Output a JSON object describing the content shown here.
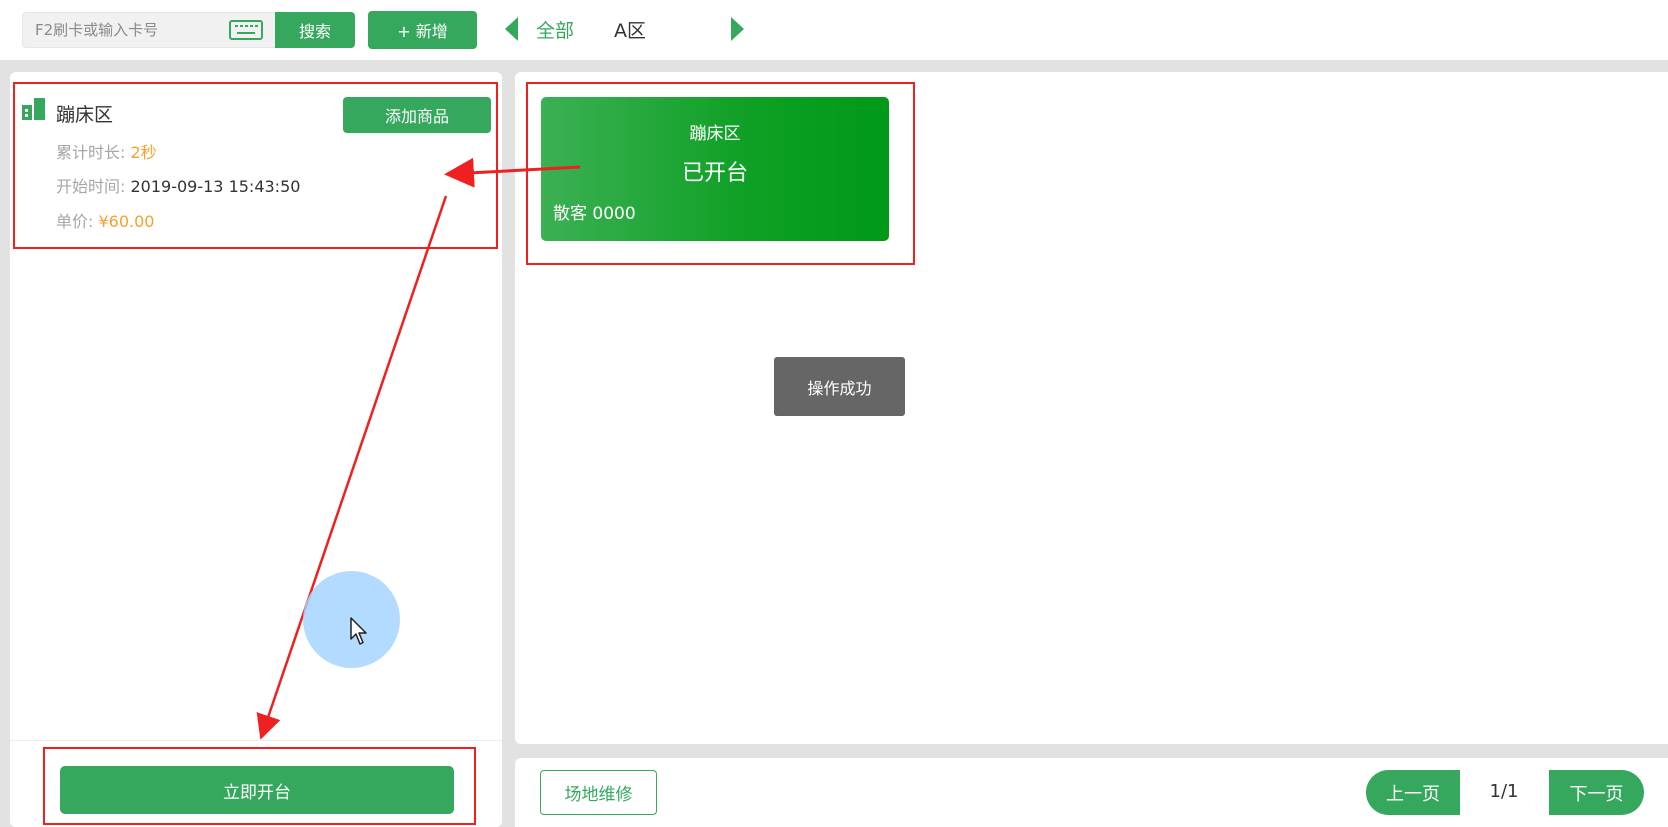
{
  "topbar": {
    "search_placeholder": "F2刷卡或输入卡号",
    "search_label": "搜索",
    "add_label": "+ 新增",
    "tabs": [
      {
        "label": "全部",
        "active": true
      },
      {
        "label": "A区",
        "active": false
      }
    ]
  },
  "left": {
    "venue_name": "蹦床区",
    "add_goods_label": "添加商品",
    "duration_label": "累计时长:",
    "duration_value": "2秒",
    "start_label": "开始时间:",
    "start_value": "2019-09-13 15:43:50",
    "price_label": "单价:",
    "price_value": "¥60.00",
    "open_now_label": "立即开台"
  },
  "card": {
    "name": "蹦床区",
    "status": "已开台",
    "guest": "散客 0000"
  },
  "toast": {
    "message": "操作成功"
  },
  "bottom": {
    "repair_label": "场地维修",
    "prev_label": "上一页",
    "page": "1/1",
    "next_label": "下一页"
  },
  "colors": {
    "primary_green": "#35a85d",
    "accent_orange": "#f5a12c",
    "annotation_red": "#ee2020"
  }
}
